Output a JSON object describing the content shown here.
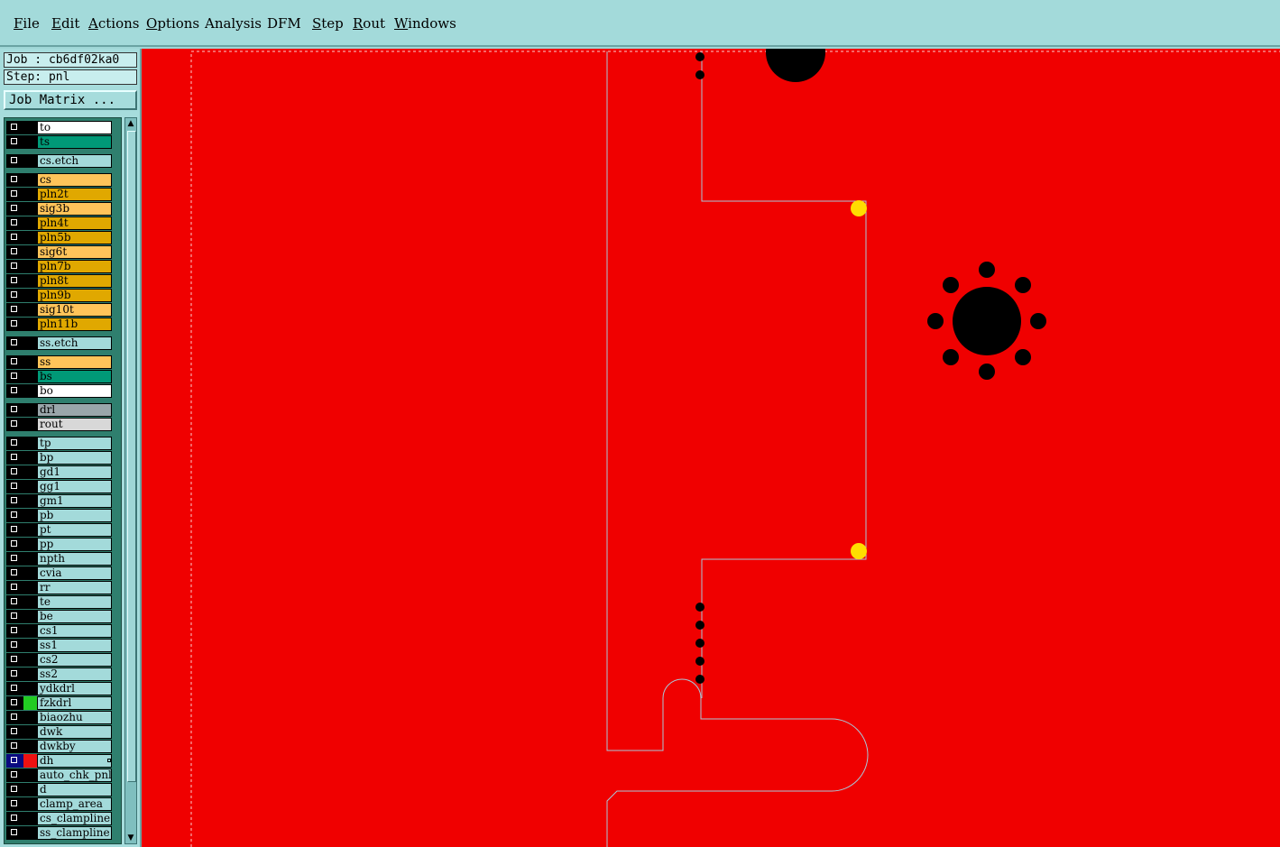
{
  "menubar": {
    "items": [
      {
        "label": "File",
        "u": "F",
        "rest": "ile"
      },
      {
        "label": "Edit",
        "u": "E",
        "rest": "dit"
      },
      {
        "label": "Actions",
        "u": "A",
        "rest": "ctions"
      },
      {
        "label": "Options",
        "u": "O",
        "rest": "ptions"
      },
      {
        "label": "Analysis",
        "u": "",
        "rest": "Analysis"
      },
      {
        "label": "DFM",
        "u": "",
        "rest": "DFM"
      },
      {
        "label": "Step",
        "u": "S",
        "rest": "tep"
      },
      {
        "label": "Rout",
        "u": "R",
        "rest": "out"
      },
      {
        "label": "Windows",
        "u": "W",
        "rest": "indows"
      }
    ]
  },
  "job": {
    "job_label": "Job : cb6df02ka0",
    "step_label": "Step: pnl",
    "job_matrix_button": "Job Matrix ..."
  },
  "layers": [
    {
      "name": "to",
      "color": "#ffffff"
    },
    {
      "name": "ts",
      "color": "#009977"
    },
    {
      "name": "cs.etch",
      "color": "#a3dada"
    },
    {
      "name": "cs",
      "color": "#ffc45a"
    },
    {
      "name": "pln2t",
      "color": "#e0a800"
    },
    {
      "name": "sig3b",
      "color": "#ffc45a"
    },
    {
      "name": "pln4t",
      "color": "#e0a800"
    },
    {
      "name": "pln5b",
      "color": "#e0a800"
    },
    {
      "name": "sig6t",
      "color": "#ffc45a"
    },
    {
      "name": "pln7b",
      "color": "#e0a800"
    },
    {
      "name": "pln8t",
      "color": "#e0a800"
    },
    {
      "name": "pln9b",
      "color": "#e0a800"
    },
    {
      "name": "sig10t",
      "color": "#ffc45a"
    },
    {
      "name": "pln11b",
      "color": "#e0a800"
    },
    {
      "name": "ss.etch",
      "color": "#a3dada"
    },
    {
      "name": "ss",
      "color": "#ffc45a"
    },
    {
      "name": "bs",
      "color": "#009977"
    },
    {
      "name": "bo",
      "color": "#ffffff"
    },
    {
      "name": "drl",
      "color": "#9aa6aa"
    },
    {
      "name": "rout",
      "color": "#d8d8d8"
    },
    {
      "name": "tp",
      "color": "#a3dada"
    },
    {
      "name": "bp",
      "color": "#a3dada"
    },
    {
      "name": "gd1",
      "color": "#a3dada"
    },
    {
      "name": "gg1",
      "color": "#a3dada"
    },
    {
      "name": "gm1",
      "color": "#a3dada"
    },
    {
      "name": "pb",
      "color": "#a3dada"
    },
    {
      "name": "pt",
      "color": "#a3dada"
    },
    {
      "name": "pp",
      "color": "#a3dada"
    },
    {
      "name": "npth",
      "color": "#a3dada"
    },
    {
      "name": "cvia",
      "color": "#a3dada"
    },
    {
      "name": "rr",
      "color": "#a3dada"
    },
    {
      "name": "te",
      "color": "#a3dada"
    },
    {
      "name": "be",
      "color": "#a3dada"
    },
    {
      "name": "cs1",
      "color": "#a3dada"
    },
    {
      "name": "ss1",
      "color": "#a3dada"
    },
    {
      "name": "cs2",
      "color": "#a3dada"
    },
    {
      "name": "ss2",
      "color": "#a3dada"
    },
    {
      "name": "ydkdrl",
      "color": "#a3dada"
    },
    {
      "name": "fzkdrl",
      "color": "#a3dada",
      "swatch": "#22cc22"
    },
    {
      "name": "biaozhu",
      "color": "#a3dada"
    },
    {
      "name": "dwk",
      "color": "#a3dada"
    },
    {
      "name": "dwkby",
      "color": "#a3dada"
    },
    {
      "name": "dh",
      "color": "#a3dada",
      "swatch": "#ee1111",
      "active": true
    },
    {
      "name": "auto_chk_pnl",
      "color": "#a3dada"
    },
    {
      "name": "d",
      "color": "#a3dada"
    },
    {
      "name": "clamp_area",
      "color": "#a3dada"
    },
    {
      "name": "cs_clampline",
      "color": "#a3dada"
    },
    {
      "name": "ss_clampline",
      "color": "#a3dada"
    }
  ],
  "canvas": {
    "background": "#f00000",
    "outline": "#a8c8d8",
    "pad_color": "#ffdd00"
  }
}
